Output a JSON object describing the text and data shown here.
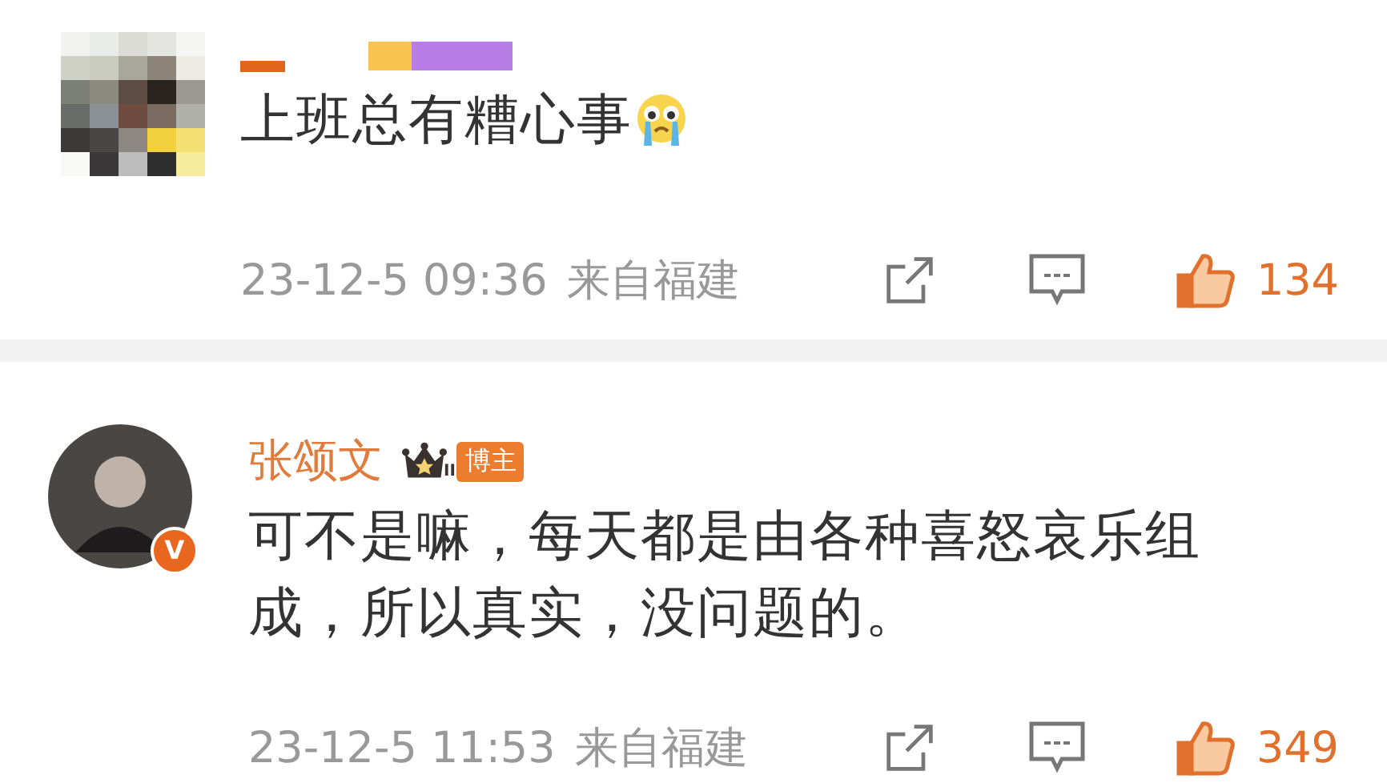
{
  "comments": [
    {
      "avatar": {
        "kind": "pixelated"
      },
      "author": {
        "kind": "redacted"
      },
      "content": "上班总有糟心事",
      "emoji": {
        "kind": "crying"
      },
      "time": "23-12-5 09:36",
      "location": "来自福建",
      "liked": true,
      "likes": "134"
    },
    {
      "avatar": {
        "kind": "photo",
        "verified_badge": "V"
      },
      "author": {
        "kind": "name",
        "name": "张颂文",
        "badge": {
          "level": "II",
          "label": "博主"
        }
      },
      "content": "可不是嘛，每天都是由各种喜怒哀乐组成，所以真实，没问题的。",
      "time": "23-12-5 11:53",
      "location": "来自福建",
      "liked": true,
      "likes": "349"
    }
  ]
}
